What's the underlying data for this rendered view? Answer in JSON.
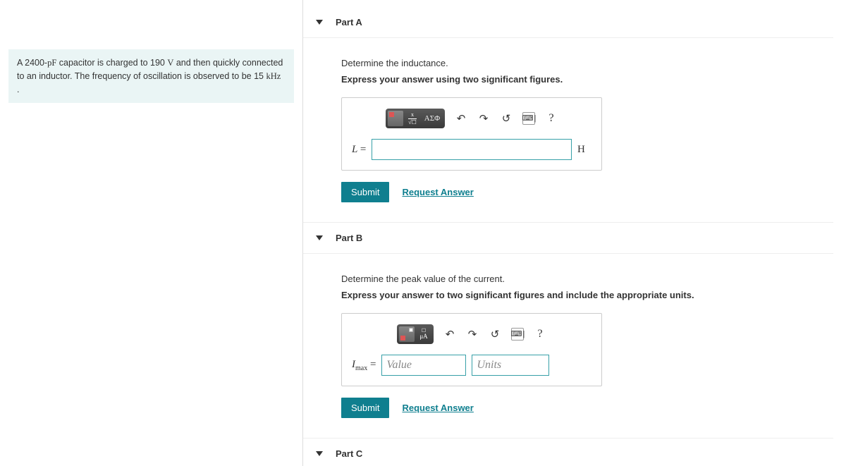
{
  "problem": {
    "text_1": "A 2400-",
    "unit_1": "pF",
    "text_2": " capacitor is charged to 190 ",
    "unit_2": "V",
    "text_3": " and then quickly connected to an inductor. The frequency of oscillation is observed to be 15 ",
    "unit_3": "kHz",
    "text_4": " ."
  },
  "parts": {
    "a": {
      "title": "Part A",
      "prompt": "Determine the inductance.",
      "instruction": "Express your answer using two significant figures.",
      "variable": "L",
      "unit": "H",
      "toolbar": {
        "greek": "ΑΣΦ"
      },
      "submit": "Submit",
      "request": "Request Answer"
    },
    "b": {
      "title": "Part B",
      "prompt": "Determine the peak value of the current.",
      "instruction": "Express your answer to two significant figures and include the appropriate units.",
      "variable_html": "I",
      "variable_sub": "max",
      "value_placeholder": "Value",
      "units_placeholder": "Units",
      "toolbar": {
        "units_hint": "μA"
      },
      "submit": "Submit",
      "request": "Request Answer"
    },
    "c": {
      "title": "Part C"
    }
  },
  "icons": {
    "help": "?",
    "undo": "↶",
    "redo": "↷",
    "reset": "↺"
  }
}
